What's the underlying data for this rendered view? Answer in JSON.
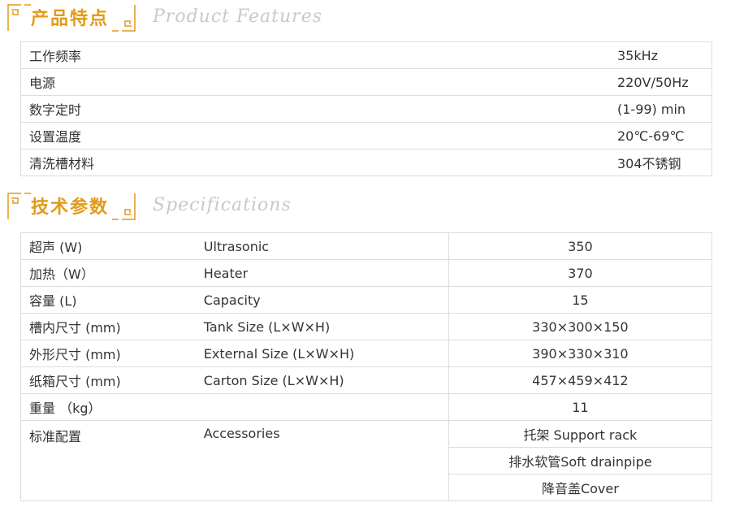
{
  "colors": {
    "accent": "#e29a1a",
    "subtitle": "#c9c9c9",
    "border": "#dcdcdc",
    "text": "#333333"
  },
  "features_header": {
    "cn": "产品特点",
    "en": "Product  Features"
  },
  "features": [
    {
      "label": "工作频率",
      "value": "35kHz"
    },
    {
      "label": "电源",
      "value": "220V/50Hz"
    },
    {
      "label": "数字定时",
      "value": "(1-99) min"
    },
    {
      "label": "设置温度",
      "value": "20℃-69℃"
    },
    {
      "label": "清洗槽材料",
      "value": "304不锈钢"
    }
  ],
  "specs_header": {
    "cn": "技术参数",
    "en": "Specifications"
  },
  "specs": [
    {
      "cn": "超声 (W)",
      "en": "Ultrasonic",
      "value": "350"
    },
    {
      "cn": "加热（W）",
      "en": "Heater",
      "value": "370"
    },
    {
      "cn": "容量 (L)",
      "en": "Capacity",
      "value": "15"
    },
    {
      "cn": "槽内尺寸 (mm)",
      "en": "Tank Size (L×W×H)",
      "value": "330×300×150"
    },
    {
      "cn": "外形尺寸 (mm)",
      "en": "External Size (L×W×H)",
      "value": "390×330×310"
    },
    {
      "cn": "纸箱尺寸 (mm)",
      "en": "Carton Size (L×W×H)",
      "value": "457×459×412"
    },
    {
      "cn": "重量 （kg）",
      "en": "",
      "value": "11"
    }
  ],
  "accessories": {
    "cn": "标准配置",
    "en": "Accessories",
    "items": [
      "托架 Support rack",
      "排水软管Soft drainpipe",
      "降音盖Cover"
    ]
  }
}
